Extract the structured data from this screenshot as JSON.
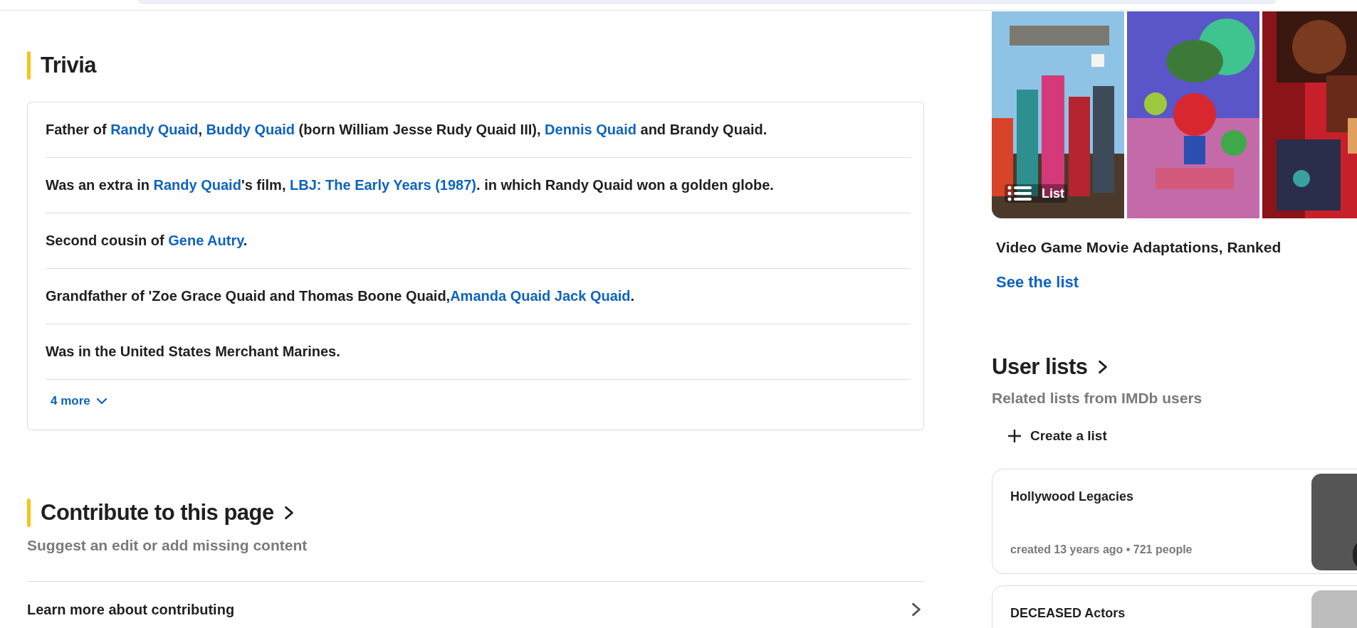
{
  "trivia": {
    "title": "Trivia",
    "items": [
      {
        "segments": [
          {
            "text": "Father of "
          },
          {
            "text": "Randy Quaid",
            "link": true
          },
          {
            "text": ", "
          },
          {
            "text": "Buddy Quaid",
            "link": true
          },
          {
            "text": " (born William Jesse Rudy Quaid III), "
          },
          {
            "text": "Dennis Quaid",
            "link": true
          },
          {
            "text": " and Brandy Quaid."
          }
        ]
      },
      {
        "segments": [
          {
            "text": "Was an extra in "
          },
          {
            "text": "Randy Quaid",
            "link": true
          },
          {
            "text": "'s film, "
          },
          {
            "text": "LBJ: The Early Years (1987)",
            "link": true
          },
          {
            "text": ". in which Randy Quaid won a golden globe."
          }
        ]
      },
      {
        "segments": [
          {
            "text": "Second cousin of "
          },
          {
            "text": "Gene Autry",
            "link": true
          },
          {
            "text": "."
          }
        ]
      },
      {
        "segments": [
          {
            "text": "Grandfather of 'Zoe Grace Quaid and Thomas Boone Quaid,"
          },
          {
            "text": "Amanda Quaid Jack Quaid",
            "link": true
          },
          {
            "text": "."
          }
        ]
      },
      {
        "segments": [
          {
            "text": "Was in the United States Merchant Marines."
          }
        ]
      }
    ],
    "more": "4 more"
  },
  "contribute": {
    "title": "Contribute to this page",
    "subtitle": "Suggest an edit or add missing content",
    "links": [
      {
        "label": "Learn more about contributing"
      }
    ]
  },
  "featured_list": {
    "badge": "List",
    "title": "Video Game Movie Adaptations, Ranked",
    "link": "See the list"
  },
  "user_lists": {
    "title": "User lists",
    "subtitle": "Related lists from IMDb users",
    "create": "Create a list",
    "lists": [
      {
        "title": "Hollywood Legacies",
        "meta": "created 13 years ago • 721 people"
      },
      {
        "title": "DECEASED Actors"
      }
    ]
  }
}
